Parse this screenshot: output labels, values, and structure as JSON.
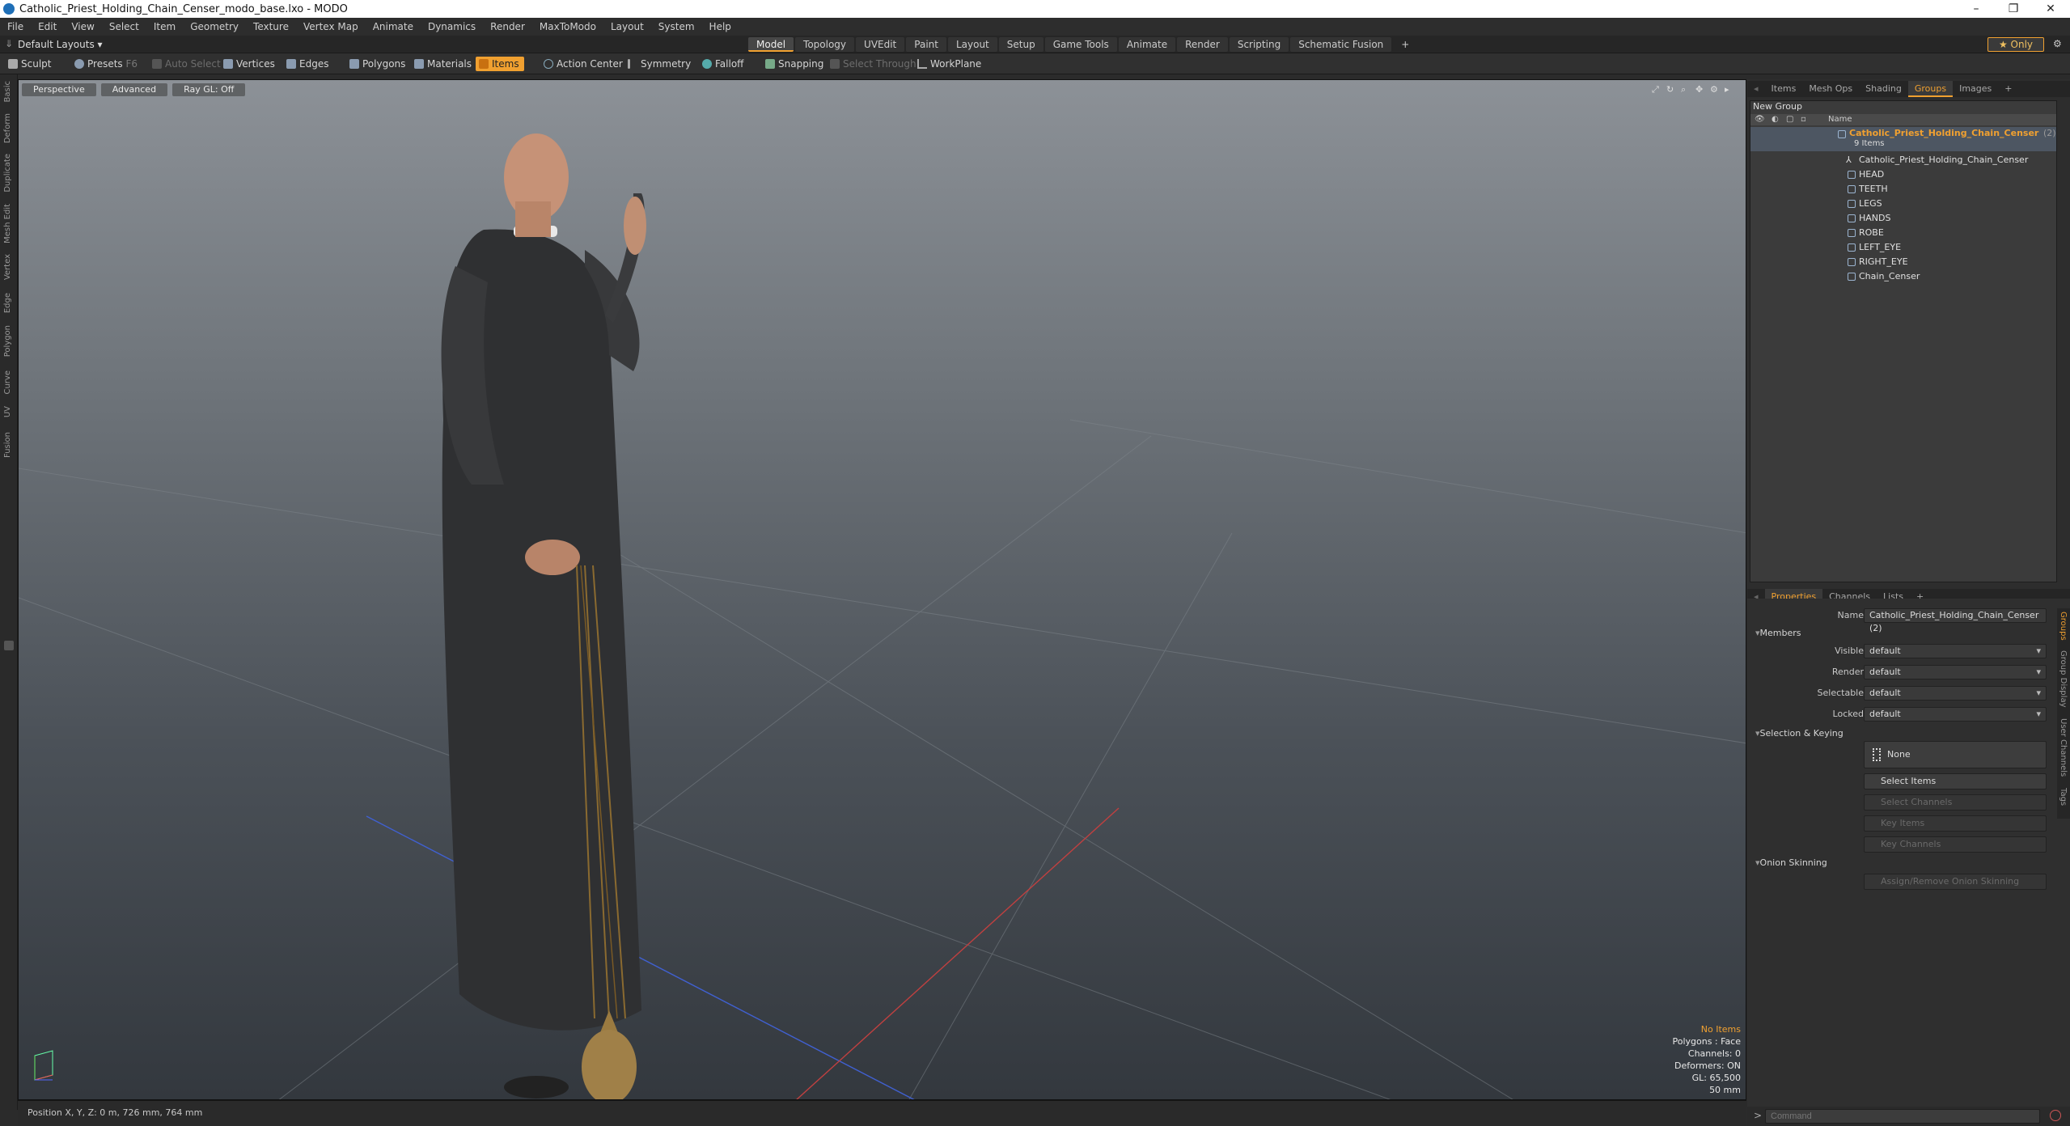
{
  "window": {
    "title": "Catholic_Priest_Holding_Chain_Censer_modo_base.lxo - MODO"
  },
  "menu": [
    "File",
    "Edit",
    "View",
    "Select",
    "Item",
    "Geometry",
    "Texture",
    "Vertex Map",
    "Animate",
    "Dynamics",
    "Render",
    "MaxToModo",
    "Layout",
    "System",
    "Help"
  ],
  "layout_selector": "Default Layouts ▾",
  "mode_tabs": [
    "Model",
    "Topology",
    "UVEdit",
    "Paint",
    "Layout",
    "Setup",
    "Game Tools",
    "Animate",
    "Render",
    "Scripting",
    "Schematic Fusion",
    "+"
  ],
  "active_mode_tab": "Model",
  "only_label": "★ Only",
  "toolbar": {
    "sculpt": "Sculpt",
    "presets": "Presets",
    "presets_key": "F6",
    "auto_select": "Auto Select",
    "vertices": "Vertices",
    "edges": "Edges",
    "polygons": "Polygons",
    "materials": "Materials",
    "items": "Items",
    "action_center": "Action Center",
    "symmetry": "Symmetry",
    "falloff": "Falloff",
    "snapping": "Snapping",
    "select_through": "Select Through",
    "workplane": "WorkPlane"
  },
  "left_tabs": [
    "Basic",
    "Deform",
    "Duplicate",
    "Mesh Edit",
    "Vertex",
    "Edge",
    "Polygon",
    "Curve",
    "UV",
    "Fusion"
  ],
  "viewport": {
    "view_mode": "Perspective",
    "shading": "Advanced",
    "raygl": "Ray GL: Off",
    "info": {
      "selection": "No Items",
      "polygons": "Polygons : Face",
      "channels": "Channels: 0",
      "deformers": "Deformers: ON",
      "gl": "GL: 65,500",
      "focal": "50 mm"
    }
  },
  "status": {
    "position": "Position X, Y, Z:   0 m, 726 mm, 764 mm"
  },
  "groups_panel": {
    "tabs": [
      "Items",
      "Mesh Ops",
      "Shading",
      "Groups",
      "Images",
      "+"
    ],
    "active_tab": "Groups",
    "new_group": "New Group",
    "col_name": "Name",
    "group_name": "Catholic_Priest_Holding_Chain_Censer",
    "group_count": "(2)",
    "group_items": "9 Items",
    "children": [
      "Catholic_Priest_Holding_Chain_Censer",
      "HEAD",
      "TEETH",
      "LEGS",
      "HANDS",
      "ROBE",
      "LEFT_EYE",
      "RIGHT_EYE",
      "Chain_Censer"
    ]
  },
  "properties": {
    "tabs": [
      "Properties",
      "Channels",
      "Lists",
      "+"
    ],
    "active_tab": "Properties",
    "name_label": "Name",
    "name_value": "Catholic_Priest_Holding_Chain_Censer (2)",
    "members": "Members",
    "visible_label": "Visible",
    "visible_value": "default",
    "render_label": "Render",
    "render_value": "default",
    "selectable_label": "Selectable",
    "selectable_value": "default",
    "locked_label": "Locked",
    "locked_value": "default",
    "sel_keying": "Selection & Keying",
    "none_btn": "None",
    "select_items": "Select Items",
    "select_channels": "Select Channels",
    "key_items": "Key Items",
    "key_channels": "Key Channels",
    "onion": "Onion Skinning",
    "onion_btn": "Assign/Remove Onion Skinning",
    "side_tabs": [
      "Groups",
      "Group Display",
      "User Channels",
      "Tags"
    ]
  },
  "command": {
    "placeholder": "Command"
  },
  "colors": {
    "accent": "#f0a030",
    "viewport_top": "#8c9197",
    "viewport_bottom": "#33383e"
  }
}
